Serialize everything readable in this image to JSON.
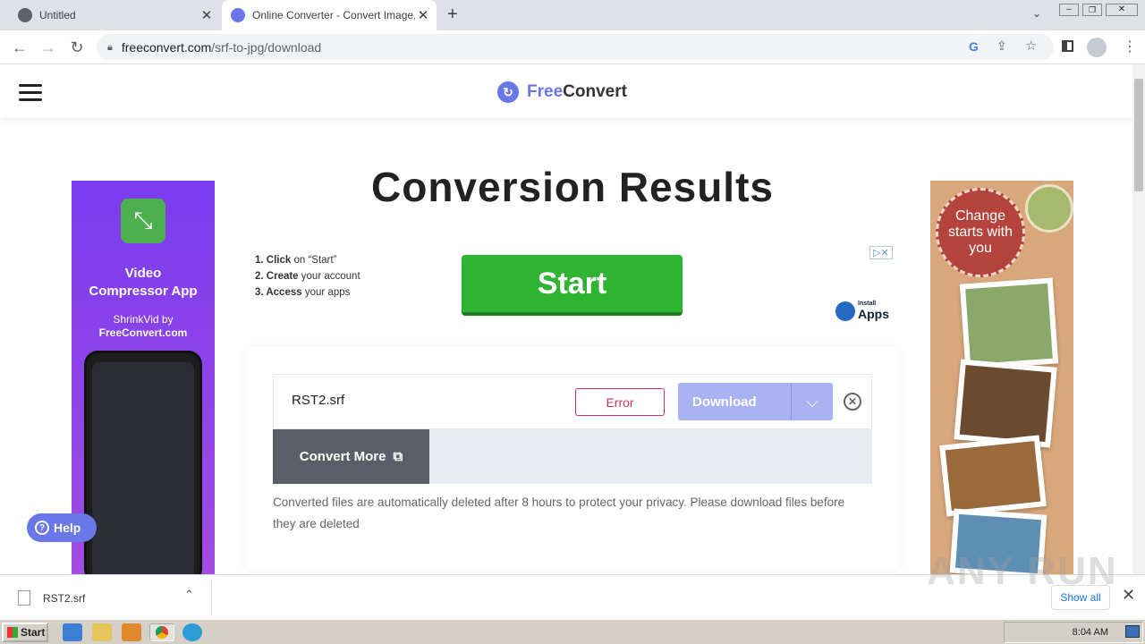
{
  "browser": {
    "tabs": [
      {
        "title": "Untitled"
      },
      {
        "title": "Online Converter - Convert Image, Video"
      }
    ],
    "new_tab": "+",
    "url_domain": "freeconvert.com",
    "url_path": "/srf-to-jpg/download"
  },
  "site": {
    "logo_free": "Free",
    "logo_convert": "Convert"
  },
  "page": {
    "title": "Conversion Results"
  },
  "ad_left": {
    "app_title": "Video Compressor App",
    "byline": "ShrinkVid by",
    "site": "FreeConvert.com"
  },
  "ad_right": {
    "badge": "Change starts with you"
  },
  "install_ad": {
    "steps": [
      {
        "bold": "1. Click",
        "rest": " on “Start”"
      },
      {
        "bold": "2. Create",
        "rest": " your account"
      },
      {
        "bold": "3. Access",
        "rest": " your apps"
      }
    ],
    "start": "Start",
    "brand_small": "Install",
    "brand": "Apps"
  },
  "file": {
    "name": "RST2.srf",
    "status": "Error",
    "download": "Download"
  },
  "convert_more": "Convert More",
  "note": "Converted files are automatically deleted after 8 hours to protect your privacy. Please download files before they are deleted",
  "help": "Help",
  "shelf": {
    "file": "RST2.srf",
    "show_all": "Show all"
  },
  "watermark": "ANY RUN",
  "taskbar": {
    "start": "Start",
    "time": "8:04 AM"
  }
}
